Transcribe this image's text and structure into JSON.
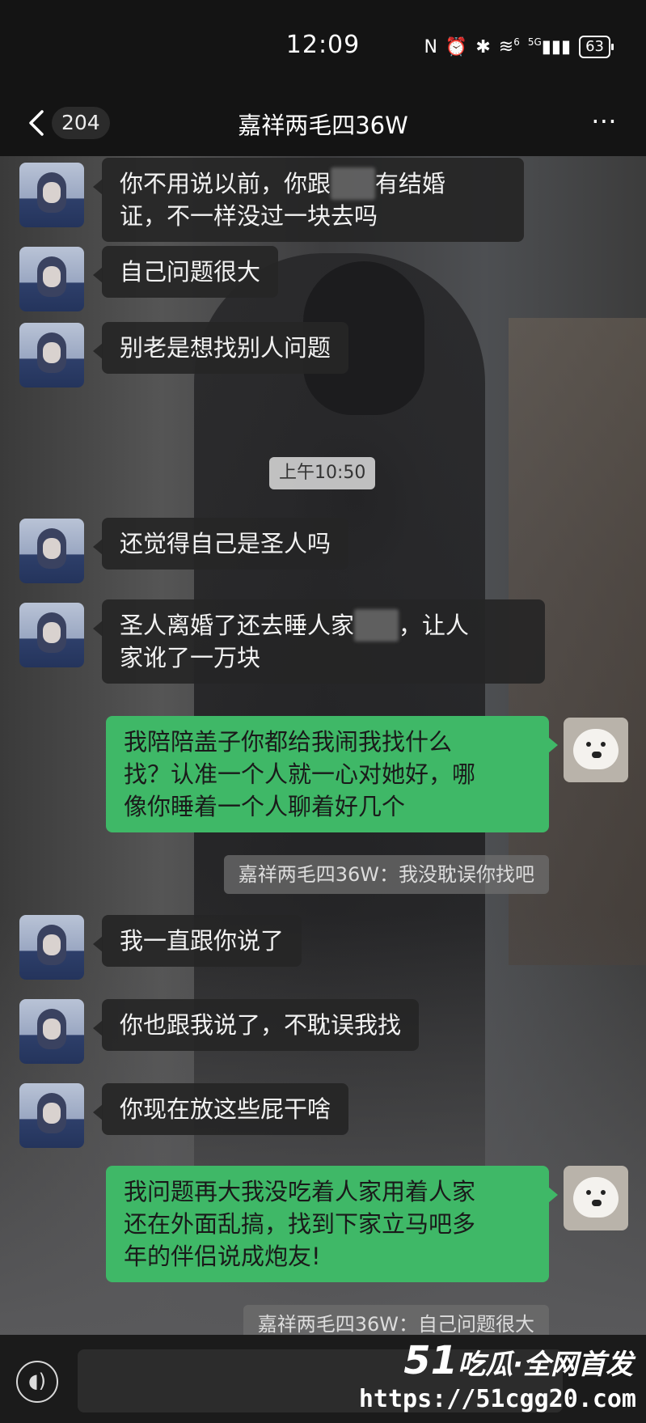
{
  "status_bar": {
    "time": "12:09",
    "signal_label": "5G",
    "wifi_badge": "6",
    "battery": "63"
  },
  "nav": {
    "unread_count": "204",
    "title": "嘉祥两毛四36W",
    "more_icon": "⋯"
  },
  "messages": {
    "m1_line1_a": "你不用说以前，你跟",
    "m1_line1_b": "有结婚",
    "m1_line2": "证，不一样没过一块去吗",
    "m2": "自己问题很大",
    "m3": "别老是想找别人问题",
    "time_divider": "上午10:50",
    "m4": "还觉得自己是圣人吗",
    "m5_line1_a": "圣人离婚了还去睡人家",
    "m5_line1_b": "，让人",
    "m5_line2": "家讹了一万块",
    "m6_line1": "我陪陪盖子你都给我闹我找什么",
    "m6_line2": "找？认准一个人就一心对她好，哪",
    "m6_line3": "像你睡着一个人聊着好几个",
    "q1": "嘉祥两毛四36W：我没耽误你找吧",
    "m7": "我一直跟你说了",
    "m8": "你也跟我说了，不耽误我找",
    "m9": "你现在放这些屁干啥",
    "m10_line1": "我问题再大我没吃着人家用着人家",
    "m10_line2": "还在外面乱搞，找到下家立马吧多",
    "m10_line3": "年的伴侣说成炮友!",
    "q2": "嘉祥两毛四36W：自己问题很大"
  },
  "watermark": {
    "brand_num": "51",
    "brand_text": "吃瓜·全网首发",
    "url": "https://51cgg20.com"
  }
}
